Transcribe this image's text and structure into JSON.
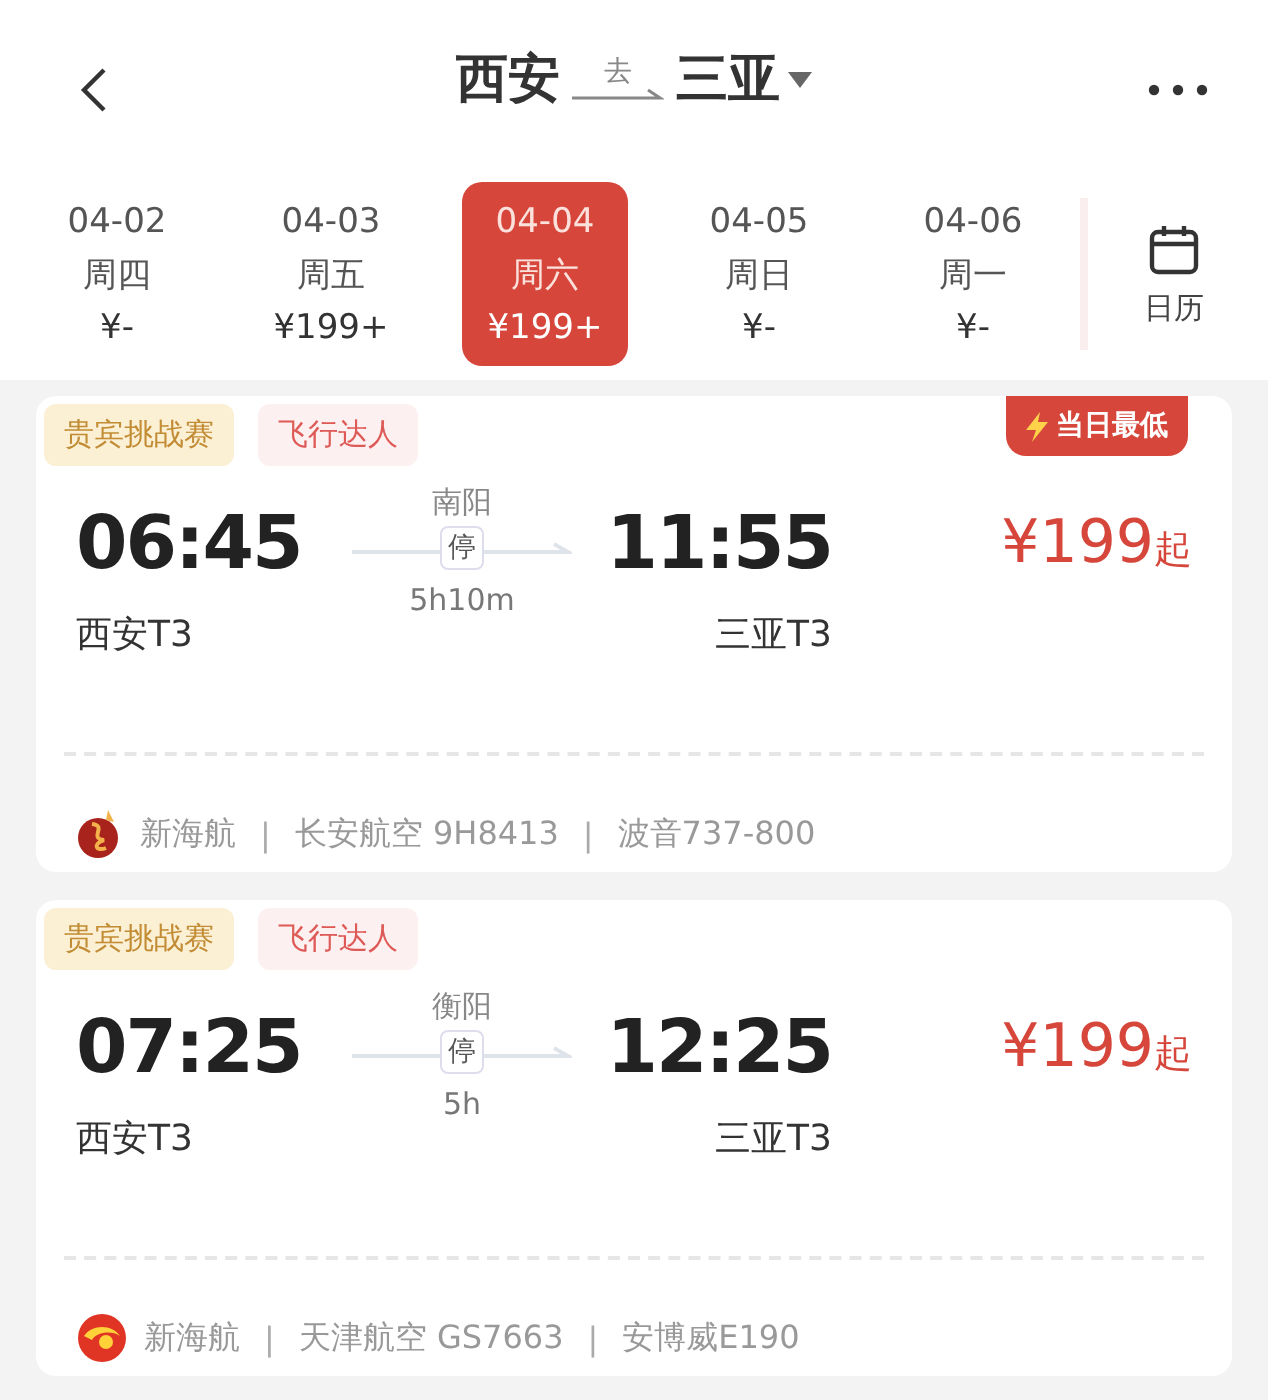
{
  "header": {
    "from": "西安",
    "direction": "去",
    "to": "三亚"
  },
  "dates": [
    {
      "date": "04-02",
      "weekday": "周四",
      "price": "¥-",
      "selected": false
    },
    {
      "date": "04-03",
      "weekday": "周五",
      "price": "¥199+",
      "selected": false
    },
    {
      "date": "04-04",
      "weekday": "周六",
      "price": "¥199+",
      "selected": true
    },
    {
      "date": "04-05",
      "weekday": "周日",
      "price": "¥-",
      "selected": false
    },
    {
      "date": "04-06",
      "weekday": "周一",
      "price": "¥-",
      "selected": false
    }
  ],
  "calendar": {
    "label": "日历"
  },
  "flights": [
    {
      "tags": [
        {
          "label": "贵宾挑战赛",
          "kind": "gold"
        },
        {
          "label": "飞行达人",
          "kind": "pink"
        }
      ],
      "badge": "当日最低",
      "depart_time": "06:45",
      "depart_airport": "西安T3",
      "stop": "南阳",
      "stop_mark": "停",
      "duration": "5h10m",
      "arrive_time": "11:55",
      "arrive_airport": "三亚T3",
      "price": "¥199",
      "price_suffix": "起",
      "airline": {
        "kind": "flame",
        "parts": [
          "新海航",
          "|",
          "长安航空 9H8413",
          "|",
          "波音737-800"
        ]
      }
    },
    {
      "tags": [
        {
          "label": "贵宾挑战赛",
          "kind": "gold"
        },
        {
          "label": "飞行达人",
          "kind": "pink"
        }
      ],
      "depart_time": "07:25",
      "depart_airport": "西安T3",
      "stop": "衡阳",
      "stop_mark": "停",
      "duration": "5h",
      "arrive_time": "12:25",
      "arrive_airport": "三亚T3",
      "price": "¥199",
      "price_suffix": "起",
      "airline": {
        "kind": "swirl",
        "parts": [
          "新海航",
          "|",
          "天津航空 GS7663",
          "|",
          "安博威E190"
        ]
      }
    }
  ]
}
